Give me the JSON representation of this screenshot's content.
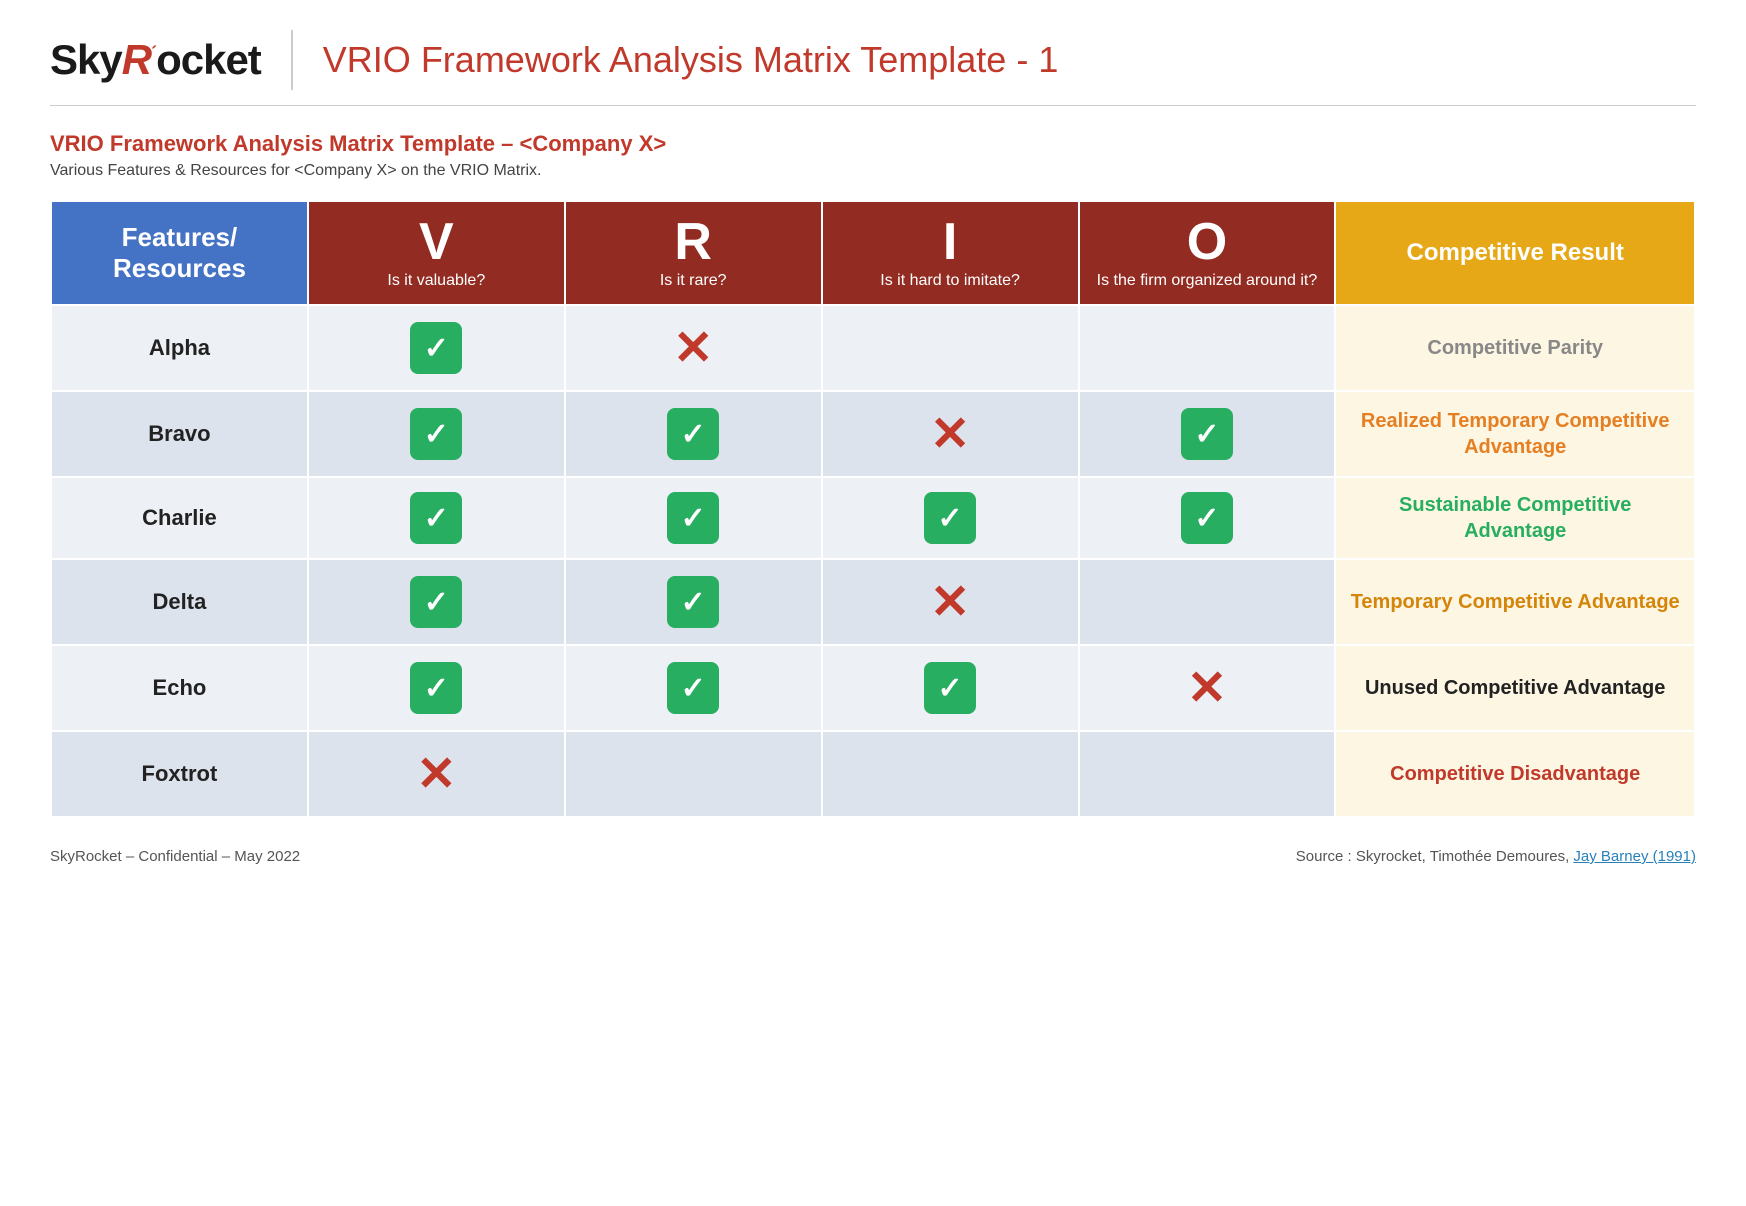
{
  "header": {
    "logo_sky": "Sky",
    "logo_r": "R",
    "logo_tick": "´",
    "logo_ocket": "ocket",
    "page_title": "VRIO Framework Analysis Matrix Template - 1"
  },
  "subtitle": {
    "title": "VRIO Framework Analysis Matrix Template – <Company X>",
    "description": "Various Features & Resources for <Company X> on the VRIO Matrix."
  },
  "table": {
    "col_features": {
      "label1": "Features/",
      "label2": "Resources"
    },
    "col_v": {
      "letter": "V",
      "sub": "Is it valuable?"
    },
    "col_r": {
      "letter": "R",
      "sub": "Is it rare?"
    },
    "col_i": {
      "letter": "I",
      "sub": "Is it hard to imitate?"
    },
    "col_o": {
      "letter": "O",
      "sub": "Is the firm organized around it?"
    },
    "col_result": "Competitive Result",
    "rows": [
      {
        "name": "Alpha",
        "v": "check",
        "r": "cross",
        "i": "",
        "o": "",
        "result": "Competitive Parity",
        "result_class": "result-gray"
      },
      {
        "name": "Bravo",
        "v": "check",
        "r": "check",
        "i": "cross",
        "o": "check",
        "result": "Realized Temporary Competitive Advantage",
        "result_class": "result-orange"
      },
      {
        "name": "Charlie",
        "v": "check",
        "r": "check",
        "i": "check",
        "o": "check",
        "result": "Sustainable Competitive Advantage",
        "result_class": "result-green"
      },
      {
        "name": "Delta",
        "v": "check",
        "r": "check",
        "i": "cross",
        "o": "",
        "result": "Temporary Competitive Advantage",
        "result_class": "result-dark-orange"
      },
      {
        "name": "Echo",
        "v": "check",
        "r": "check",
        "i": "check",
        "o": "cross",
        "result": "Unused Competitive Advantage",
        "result_class": "result-black"
      },
      {
        "name": "Foxtrot",
        "v": "cross",
        "r": "",
        "i": "",
        "o": "",
        "result": "Competitive Disadvantage",
        "result_class": "result-red"
      }
    ]
  },
  "footer": {
    "left": "SkyRocket – Confidential – May 2022",
    "right_text": "Source : Skyrocket, Timothée Demoures,",
    "right_link_text": "Jay Barney (1991)",
    "right_link_href": "#"
  }
}
